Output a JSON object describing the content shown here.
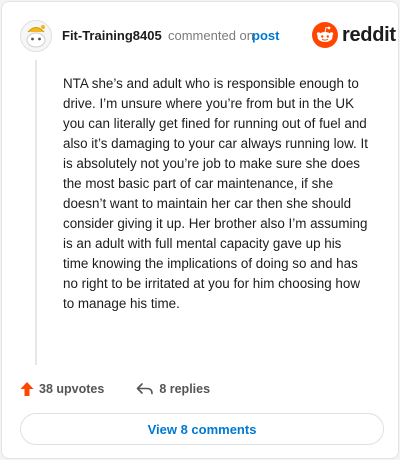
{
  "comment": {
    "username": "Fit-Training8405",
    "action_text": "commented on",
    "post_link": "post",
    "body": "NTA she’s and adult who is responsible enough to drive. I’m unsure where you’re from but in the UK you can literally get fined for running out of fuel and also it’s damaging to your car always running low. It is absolutely not you’re job to make sure she does the most basic part of car maintenance, if she doesn’t want to maintain her car then she should consider giving it up. Her brother also I’m assuming is an adult with full mental capacity gave up his time knowing the implications of doing so and has no right to be irritated at you for him choosing how to manage his time."
  },
  "brand": {
    "wordmark": "reddit",
    "icon": "reddit-snoo-icon",
    "color": "#ff4500"
  },
  "avatar": {
    "icon": "snoo-avatar-icon"
  },
  "stats": {
    "upvotes_label": "38 upvotes",
    "replies_label": "8 replies",
    "upvote_icon": "upvote-arrow-icon",
    "reply_icon": "reply-arrow-icon",
    "upvote_color": "#ff4500"
  },
  "footer": {
    "view_comments_label": "View 8 comments"
  },
  "colors": {
    "link": "#0079d3",
    "text": "#1c1c1c",
    "muted": "#787c7e"
  }
}
